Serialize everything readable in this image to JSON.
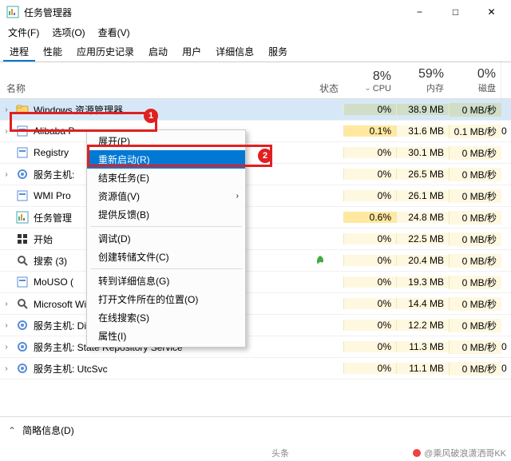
{
  "window": {
    "title": "任务管理器",
    "buttons": {
      "min": "−",
      "max": "□",
      "close": "✕"
    }
  },
  "menubar": [
    "文件(F)",
    "选项(O)",
    "查看(V)"
  ],
  "tabs": [
    "进程",
    "性能",
    "应用历史记录",
    "启动",
    "用户",
    "详细信息",
    "服务"
  ],
  "columns": {
    "name": "名称",
    "status": "状态",
    "cpu": {
      "pct": "8%",
      "label": "CPU"
    },
    "mem": {
      "pct": "59%",
      "label": "内存"
    },
    "disk": {
      "pct": "0%",
      "label": "磁盘"
    }
  },
  "processes": [
    {
      "exp": "›",
      "icon": "folder",
      "name": "Windows 资源管理器",
      "status": "",
      "cpu": "0%",
      "mem": "38.9 MB",
      "disk": "0 MB/秒",
      "more": "",
      "selected": true
    },
    {
      "exp": "›",
      "icon": "app",
      "name": "Alibaba P",
      "status": "",
      "cpu": "0.1%",
      "mem": "31.6 MB",
      "disk": "0.1 MB/秒",
      "more": "0",
      "hot": true
    },
    {
      "exp": "",
      "icon": "app",
      "name": "Registry",
      "status": "",
      "cpu": "0%",
      "mem": "30.1 MB",
      "disk": "0 MB/秒",
      "more": ""
    },
    {
      "exp": "›",
      "icon": "gear",
      "name": "服务主机:",
      "status": "",
      "cpu": "0%",
      "mem": "26.5 MB",
      "disk": "0 MB/秒",
      "more": ""
    },
    {
      "exp": "",
      "icon": "app",
      "name": "WMI Pro",
      "status": "",
      "cpu": "0%",
      "mem": "26.1 MB",
      "disk": "0 MB/秒",
      "more": ""
    },
    {
      "exp": "",
      "icon": "taskmgr",
      "name": "任务管理",
      "status": "",
      "cpu": "0.6%",
      "mem": "24.8 MB",
      "disk": "0 MB/秒",
      "more": "",
      "hot": true
    },
    {
      "exp": "",
      "icon": "start",
      "name": "开始",
      "status": "",
      "cpu": "0%",
      "mem": "22.5 MB",
      "disk": "0 MB/秒",
      "more": ""
    },
    {
      "exp": "",
      "icon": "search",
      "name": "搜索 (3)",
      "status": "leaf",
      "cpu": "0%",
      "mem": "20.4 MB",
      "disk": "0 MB/秒",
      "more": ""
    },
    {
      "exp": "",
      "icon": "app",
      "name": "MoUSO (",
      "status": "",
      "cpu": "0%",
      "mem": "19.3 MB",
      "disk": "0 MB/秒",
      "more": ""
    },
    {
      "exp": "›",
      "icon": "search",
      "name": "Microsoft Windows Search 索引器",
      "status": "",
      "cpu": "0%",
      "mem": "14.4 MB",
      "disk": "0 MB/秒",
      "more": ""
    },
    {
      "exp": "›",
      "icon": "gear",
      "name": "服务主机: Diagnostic Policy Service",
      "status": "",
      "cpu": "0%",
      "mem": "12.2 MB",
      "disk": "0 MB/秒",
      "more": ""
    },
    {
      "exp": "›",
      "icon": "gear",
      "name": "服务主机: State Repository Service",
      "status": "",
      "cpu": "0%",
      "mem": "11.3 MB",
      "disk": "0 MB/秒",
      "more": "0"
    },
    {
      "exp": "›",
      "icon": "gear",
      "name": "服务主机: UtcSvc",
      "status": "",
      "cpu": "0%",
      "mem": "11.1 MB",
      "disk": "0 MB/秒",
      "more": "0"
    }
  ],
  "context_menu": {
    "items": [
      {
        "label": "展开(P)"
      },
      {
        "label": "重新启动(R)",
        "highlight": true
      },
      {
        "label": "结束任务(E)"
      },
      {
        "label": "资源值(V)",
        "submenu": true
      },
      {
        "label": "提供反馈(B)"
      },
      {
        "sep": true
      },
      {
        "label": "调试(D)"
      },
      {
        "label": "创建转储文件(C)"
      },
      {
        "sep": true
      },
      {
        "label": "转到详细信息(G)"
      },
      {
        "label": "打开文件所在的位置(O)"
      },
      {
        "label": "在线搜索(S)"
      },
      {
        "label": "属性(I)"
      }
    ]
  },
  "annotations": {
    "badge1": "1",
    "badge2": "2"
  },
  "footer": {
    "label": "简略信息(D)"
  },
  "watermark": {
    "left": "头条",
    "right": "@乘风破浪潇洒哥KK"
  }
}
